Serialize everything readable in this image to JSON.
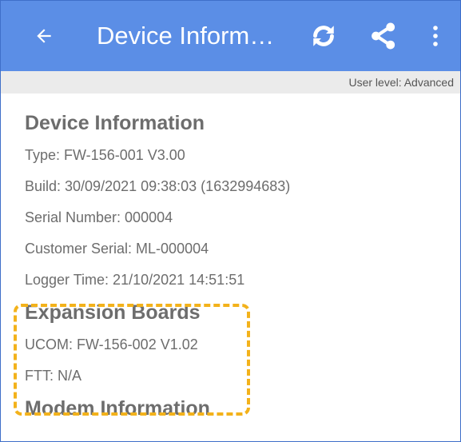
{
  "appbar": {
    "title": "Device Inform…",
    "back_icon": "arrow-left-icon",
    "refresh_icon": "refresh-icon",
    "share_icon": "share-icon",
    "more_icon": "more-vertical-icon",
    "color": "#5b8ee6"
  },
  "user_level": "User level: Advanced",
  "device_information": {
    "heading": "Device Information",
    "type": "Type: FW-156-001 V3.00",
    "build": "Build: 30/09/2021 09:38:03 (1632994683)",
    "serial_number": "Serial Number:  000004",
    "customer_serial": "Customer Serial: ML-000004",
    "logger_time": "Logger Time: 21/10/2021 14:51:51"
  },
  "expansion_boards": {
    "heading": "Expansion Boards",
    "ucom": "UCOM: FW-156-002 V1.02",
    "ftt": "FTT: N/A",
    "highlight_color": "#f3b21b"
  },
  "modem_information": {
    "heading": "Modem Information"
  }
}
